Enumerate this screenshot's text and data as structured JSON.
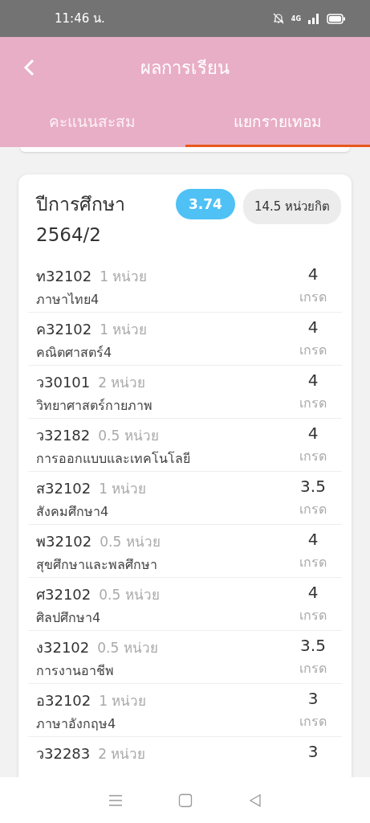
{
  "status_bar": {
    "time": "11:46 น.",
    "network": "4G"
  },
  "header": {
    "title": "ผลการเรียน"
  },
  "tabs": [
    {
      "label": "คะแนนสะสม",
      "selected": false
    },
    {
      "label": "แยกรายเทอม",
      "selected": true
    }
  ],
  "semester": {
    "title": "ปีการศึกษา 2564/2",
    "gpa": "3.74",
    "credits": "14.5 หน่วยกิต"
  },
  "courses": [
    {
      "code": "ท32102",
      "units": "1 หน่วย",
      "name": "ภาษาไทย4",
      "grade": "4",
      "grade_label": "เกรด"
    },
    {
      "code": "ค32102",
      "units": "1 หน่วย",
      "name": "คณิตศาสตร์4",
      "grade": "4",
      "grade_label": "เกรด"
    },
    {
      "code": "ว30101",
      "units": "2 หน่วย",
      "name": "วิทยาศาสตร์กายภาพ",
      "grade": "4",
      "grade_label": "เกรด"
    },
    {
      "code": "ว32182",
      "units": "0.5 หน่วย",
      "name": "การออกแบบและเทคโนโลยี",
      "grade": "4",
      "grade_label": "เกรด"
    },
    {
      "code": "ส32102",
      "units": "1 หน่วย",
      "name": "สังคมศึกษา4",
      "grade": "3.5",
      "grade_label": "เกรด"
    },
    {
      "code": "พ32102",
      "units": "0.5 หน่วย",
      "name": "สุขศึกษาและพลศึกษา",
      "grade": "4",
      "grade_label": "เกรด"
    },
    {
      "code": "ศ32102",
      "units": "0.5 หน่วย",
      "name": "ศิลปศึกษา4",
      "grade": "4",
      "grade_label": "เกรด"
    },
    {
      "code": "ง32102",
      "units": "0.5 หน่วย",
      "name": "การงานอาชีพ",
      "grade": "3.5",
      "grade_label": "เกรด"
    },
    {
      "code": "อ32102",
      "units": "1 หน่วย",
      "name": "ภาษาอังกฤษ4",
      "grade": "3",
      "grade_label": "เกรด"
    },
    {
      "code": "ว32283",
      "units": "2 หน่วย",
      "grade": "3"
    }
  ]
}
